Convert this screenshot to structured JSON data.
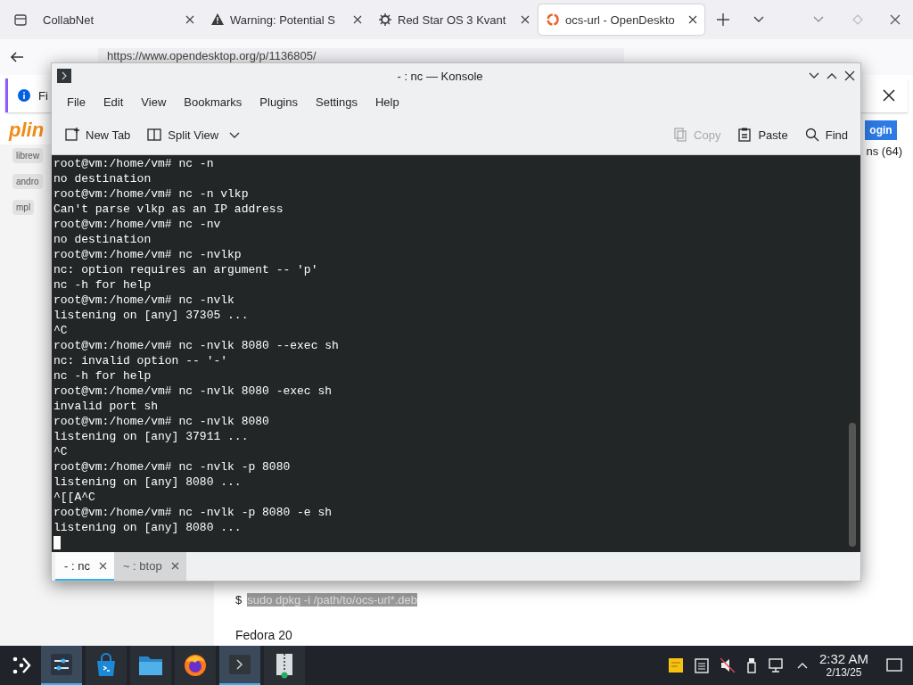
{
  "browser": {
    "tabs": [
      {
        "title": "CollabNet",
        "selected": false
      },
      {
        "title": "Warning: Potential S",
        "selected": false
      },
      {
        "title": "Red Star OS 3 Kvant",
        "selected": false
      },
      {
        "title": "ocs-url - OpenDeskto",
        "selected": true
      }
    ],
    "url": "https://www.opendesktop.org/p/1136805/",
    "notice": "Fi",
    "logo": "plin",
    "login": "ogin",
    "count": "ns (64)",
    "chips": [
      "librew",
      "andro",
      "mpl"
    ],
    "command_prompt": "$",
    "command": "sudo dpkg -i /path/to/ocs-url*.deb",
    "heading": "Fedora 20"
  },
  "konsole": {
    "title": "- : nc — Konsole",
    "menu": [
      "File",
      "Edit",
      "View",
      "Bookmarks",
      "Plugins",
      "Settings",
      "Help"
    ],
    "toolbar": [
      {
        "label": "New Tab",
        "disabled": false
      },
      {
        "label": "Split View",
        "disabled": false
      },
      {
        "label": "Copy",
        "disabled": true
      },
      {
        "label": "Paste",
        "disabled": false
      },
      {
        "label": "Find",
        "disabled": false
      }
    ],
    "lines": [
      "root@vm:/home/vm# nc -n",
      "no destination",
      "root@vm:/home/vm# nc -n vlkp",
      "Can't parse vlkp as an IP address",
      "root@vm:/home/vm# nc -nv",
      "no destination",
      "root@vm:/home/vm# nc -nvlkp",
      "nc: option requires an argument -- 'p'",
      "nc -h for help",
      "root@vm:/home/vm# nc -nvlk",
      "listening on [any] 37305 ...",
      "^C",
      "root@vm:/home/vm# nc -nvlk 8080 --exec sh",
      "nc: invalid option -- '-'",
      "nc -h for help",
      "root@vm:/home/vm# nc -nvlk 8080 -exec sh",
      "invalid port sh",
      "root@vm:/home/vm# nc -nvlk 8080",
      "listening on [any] 37911 ...",
      "^C",
      "root@vm:/home/vm# nc -nvlk -p 8080",
      "listening on [any] 8080 ...",
      "^[[A^C",
      "root@vm:/home/vm# nc -nvlk -p 8080 -e sh",
      "listening on [any] 8080 ..."
    ],
    "tabs": [
      {
        "title": "- : nc",
        "selected": true
      },
      {
        "title": "~ : btop",
        "selected": false
      }
    ]
  },
  "taskbar": {
    "apps": [
      {
        "selected": true
      },
      {
        "selected": false
      },
      {
        "selected": false
      },
      {
        "selected": false
      },
      {
        "selected": true
      },
      {
        "selected": false
      }
    ],
    "time": "2:32 AM",
    "date": "2/13/25"
  }
}
